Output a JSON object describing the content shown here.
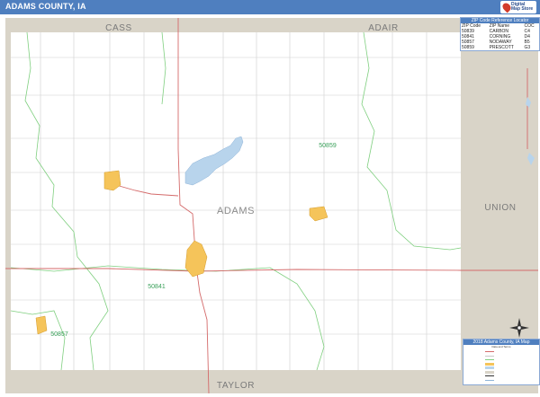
{
  "title": "ADAMS COUNTY, IA",
  "logo": {
    "line1": "Digital\nMap Store"
  },
  "colors": {
    "title_bar": "#4f7fbf",
    "border_counties": "#d9d4c8",
    "zip_boundary": "#7fcf7f",
    "city_fill": "#f5c45a",
    "water": "#b8d4ec",
    "highway": "#d46a6a",
    "road": "#c8c8c8",
    "zip_text": "#3aa05a"
  },
  "map": {
    "neighbors": {
      "north_left": "CASS",
      "north_right": "ADAIR",
      "east": "UNION",
      "south": "TAYLOR"
    },
    "county_name": "ADAMS",
    "zip_labels": [
      "50859",
      "50841",
      "50857"
    ]
  },
  "zip_table": {
    "title": "ZIP Code Reference Locator",
    "headers": [
      "ZIP Code",
      "ZIP Name",
      "COC"
    ],
    "rows": [
      [
        "50839",
        "CARBON",
        "C4"
      ],
      [
        "50841",
        "CORNING",
        "D4"
      ],
      [
        "50857",
        "NODAWAY",
        "B5"
      ],
      [
        "50859",
        "PRESCOTT",
        "G3"
      ]
    ]
  },
  "legend": {
    "title": "2018 Adams County, IA Map",
    "subtitle": "Data and Terms"
  },
  "compass": {
    "icon": "compass-rose-icon"
  }
}
